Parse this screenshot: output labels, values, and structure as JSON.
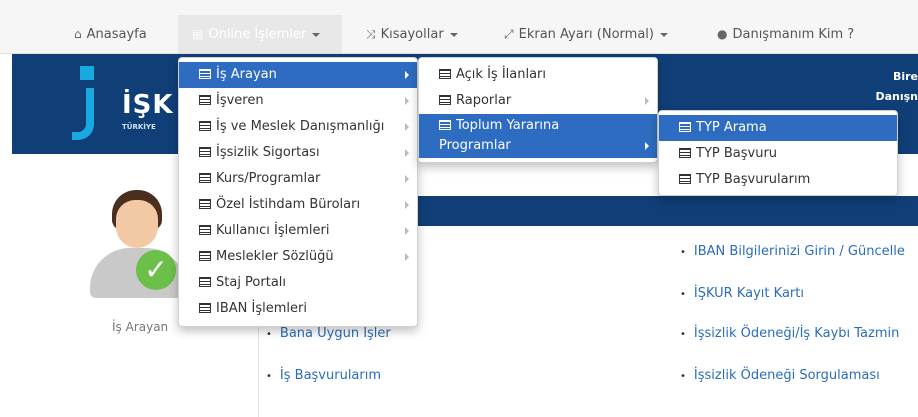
{
  "navbar": {
    "home": "Anasayfa",
    "online": "Online İşlemler",
    "shortcuts": "Kısayollar",
    "screen": "Ekran Ayarı (Normal)",
    "advisor": "Danışmanım Kim ?"
  },
  "banner": {
    "logo": "İŞK",
    "logo_sub": "TÜRKİYE",
    "right_line1": "Bire",
    "right_line2": "Danışn"
  },
  "menu_main": {
    "items": [
      "İş Arayan",
      "İşveren",
      "İş ve Meslek Danışmanlığı",
      "İşsizlik Sigortası",
      "Kurs/Programlar",
      "Özel İstihdam Büroları",
      "Kullanıcı İşlemleri",
      "Meslekler Sözlüğü",
      "Staj Portalı",
      "IBAN İşlemleri"
    ]
  },
  "menu_job_seeker": {
    "items": [
      "Açık İş İlanları",
      "Raporlar"
    ],
    "two_line_item": [
      "Toplum Yararına",
      "Programlar"
    ]
  },
  "menu_typ": {
    "items": [
      "TYP Arama",
      "TYP Başvuru",
      "TYP Başvurularım"
    ]
  },
  "profile": {
    "label": "İş Arayan"
  },
  "links_left": [
    "Bana Uygun İşler",
    "İş Başvurularım"
  ],
  "links_right": [
    "IBAN Bilgilerinizi Girin / Güncelle",
    "İŞKUR Kayıt Kartı",
    "İşsizlik Ödeneği/İş Kaybı Tazmin",
    "İşsizlik Ödeneği Sorgulaması"
  ]
}
